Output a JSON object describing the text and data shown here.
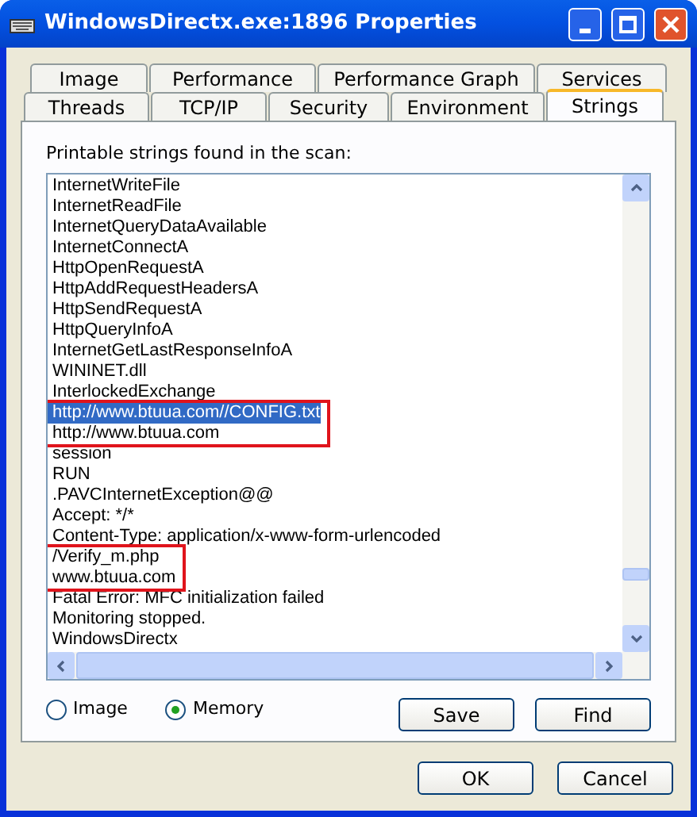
{
  "window": {
    "title": "WindowsDirectx.exe:1896 Properties"
  },
  "tab_rows": [
    [
      {
        "label": "Image",
        "selected": false
      },
      {
        "label": "Performance",
        "selected": false
      },
      {
        "label": "Performance Graph",
        "selected": false
      },
      {
        "label": "Services",
        "selected": false
      }
    ],
    [
      {
        "label": "Threads",
        "selected": false
      },
      {
        "label": "TCP/IP",
        "selected": false
      },
      {
        "label": "Security",
        "selected": false
      },
      {
        "label": "Environment",
        "selected": false
      },
      {
        "label": "Strings",
        "selected": true
      }
    ]
  ],
  "caption": "Printable strings found in the scan:",
  "strings": [
    {
      "text": "InternetWriteFile",
      "selected": false,
      "boxed": false
    },
    {
      "text": "InternetReadFile",
      "selected": false,
      "boxed": false
    },
    {
      "text": "InternetQueryDataAvailable",
      "selected": false,
      "boxed": false
    },
    {
      "text": "InternetConnectA",
      "selected": false,
      "boxed": false
    },
    {
      "text": "HttpOpenRequestA",
      "selected": false,
      "boxed": false
    },
    {
      "text": "HttpAddRequestHeadersA",
      "selected": false,
      "boxed": false
    },
    {
      "text": "HttpSendRequestA",
      "selected": false,
      "boxed": false
    },
    {
      "text": "HttpQueryInfoA",
      "selected": false,
      "boxed": false
    },
    {
      "text": "InternetGetLastResponseInfoA",
      "selected": false,
      "boxed": false
    },
    {
      "text": "WININET.dll",
      "selected": false,
      "boxed": false
    },
    {
      "text": "InterlockedExchange",
      "selected": false,
      "boxed": false
    },
    {
      "text": "http://www.btuua.com//CONFIG.txt",
      "selected": true,
      "boxed": true
    },
    {
      "text": "http://www.btuua.com",
      "selected": false,
      "boxed": true
    },
    {
      "text": "session",
      "selected": false,
      "boxed": false
    },
    {
      "text": "RUN",
      "selected": false,
      "boxed": false
    },
    {
      "text": ".PAVCInternetException@@",
      "selected": false,
      "boxed": false
    },
    {
      "text": "Accept: */*",
      "selected": false,
      "boxed": false
    },
    {
      "text": "Content-Type: application/x-www-form-urlencoded",
      "selected": false,
      "boxed": false
    },
    {
      "text": "/Verify_m.php",
      "selected": false,
      "boxed": true
    },
    {
      "text": "www.btuua.com",
      "selected": false,
      "boxed": true
    },
    {
      "text": "Fatal Error: MFC initialization failed",
      "selected": false,
      "boxed": false
    },
    {
      "text": "Monitoring stopped.",
      "selected": false,
      "boxed": false
    },
    {
      "text": "WindowsDirectx",
      "selected": false,
      "boxed": false
    }
  ],
  "source": [
    {
      "label": "Image",
      "selected": false
    },
    {
      "label": "Memory",
      "selected": true
    }
  ],
  "actions": [
    "Save",
    "Find"
  ],
  "buttons": [
    "OK",
    "Cancel"
  ]
}
